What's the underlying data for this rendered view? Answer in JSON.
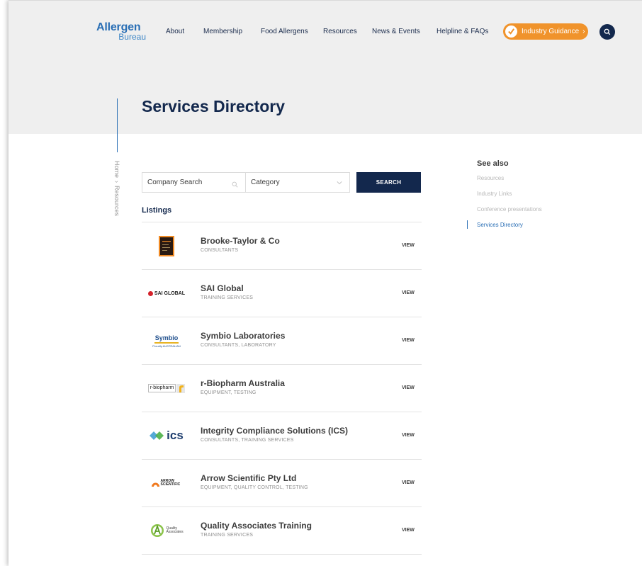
{
  "brand": {
    "line1": "Allergen",
    "line2": "Bureau"
  },
  "nav": {
    "items": [
      "About",
      "Membership",
      "Food Allergens",
      "Resources",
      "News & Events",
      "Helpline & FAQs"
    ],
    "guidance_label": "Industry Guidance",
    "guidance_icon": "check-icon",
    "search_icon": "search-icon"
  },
  "breadcrumb": [
    "Home",
    "›",
    "Resources"
  ],
  "page": {
    "title": "Services Directory"
  },
  "search": {
    "company_placeholder": "Company Search",
    "category_value": "Category",
    "button_label": "SEARCH"
  },
  "listings": {
    "heading": "Listings",
    "items": [
      {
        "name": "Brooke-Taylor & Co",
        "category": "CONSULTANTS",
        "view": "VIEW",
        "logo": "brooke-taylor-logo"
      },
      {
        "name": "SAI Global",
        "category": "TRAINING SERVICES",
        "view": "VIEW",
        "logo": "sai-global-logo",
        "logo_text": "SAI GLOBAL"
      },
      {
        "name": "Symbio Laboratories",
        "category": "CONSULTANTS, LABORATORY",
        "view": "VIEW",
        "logo": "symbio-logo",
        "logo_text": "Symbio",
        "logo_sub": "Proudly AUSTRALIAN"
      },
      {
        "name": "r-Biopharm Australia",
        "category": "EQUIPMENT, TESTING",
        "view": "VIEW",
        "logo": "r-biopharm-logo",
        "logo_text": "r-biopharm"
      },
      {
        "name": "Integrity Compliance Solutions (ICS)",
        "category": "CONSULTANTS, TRAINING SERVICES",
        "view": "VIEW",
        "logo": "ics-logo",
        "logo_text": "ics"
      },
      {
        "name": "Arrow Scientific Pty Ltd",
        "category": "EQUIPMENT, QUALITY CONTROL, TESTING",
        "view": "VIEW",
        "logo": "arrow-scientific-logo",
        "logo_text": "ARROW SCIENTIFIC"
      },
      {
        "name": "Quality Associates Training",
        "category": "TRAINING SERVICES",
        "view": "VIEW",
        "logo": "quality-associates-logo",
        "logo_text": "Quality Associates"
      }
    ]
  },
  "see_also": {
    "heading": "See also",
    "items": [
      "Resources",
      "Industry Links",
      "Conference presentations",
      "Services Directory"
    ],
    "active": "Services Directory"
  },
  "colors": {
    "navy": "#13284d",
    "blue": "#2a6fb5",
    "orange": "#f0932b",
    "hero_bg": "#efefef"
  }
}
